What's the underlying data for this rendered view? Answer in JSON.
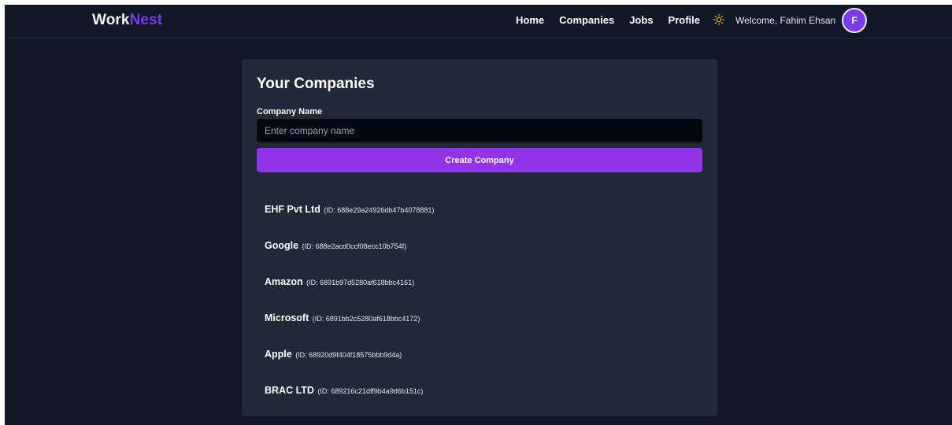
{
  "navbar": {
    "logo_primary": "Work",
    "logo_accent": "Nest",
    "links": [
      "Home",
      "Companies",
      "Jobs",
      "Profile"
    ],
    "theme_icon": "sun-icon",
    "welcome_text": "Welcome, Fahim Ehsan",
    "avatar_initial": "F"
  },
  "card": {
    "title": "Your Companies",
    "field_label": "Company Name",
    "input_placeholder": "Enter company name",
    "input_value": "",
    "create_button_label": "Create Company"
  },
  "companies": [
    {
      "name": "EHF Pvt Ltd",
      "id_text": "(ID: 688e29a24926db47b4078881)"
    },
    {
      "name": "Google",
      "id_text": "(ID: 688e2acd0ccf08ecc10b754f)"
    },
    {
      "name": "Amazon",
      "id_text": "(ID: 6891b97d5280af618bbc4161)"
    },
    {
      "name": "Microsoft",
      "id_text": "(ID: 6891bb2c5280af618bbc4172)"
    },
    {
      "name": "Apple",
      "id_text": "(ID: 68920d9f404f18575bbb9d4a)"
    },
    {
      "name": "BRAC LTD",
      "id_text": "(ID: 689216c21dff9b4a9d6b151c)"
    }
  ],
  "colors": {
    "background": "#111827",
    "card": "#1f2937",
    "accent": "#9333ea",
    "logo_accent": "#7c3aed",
    "theme_icon": "#eab308"
  }
}
